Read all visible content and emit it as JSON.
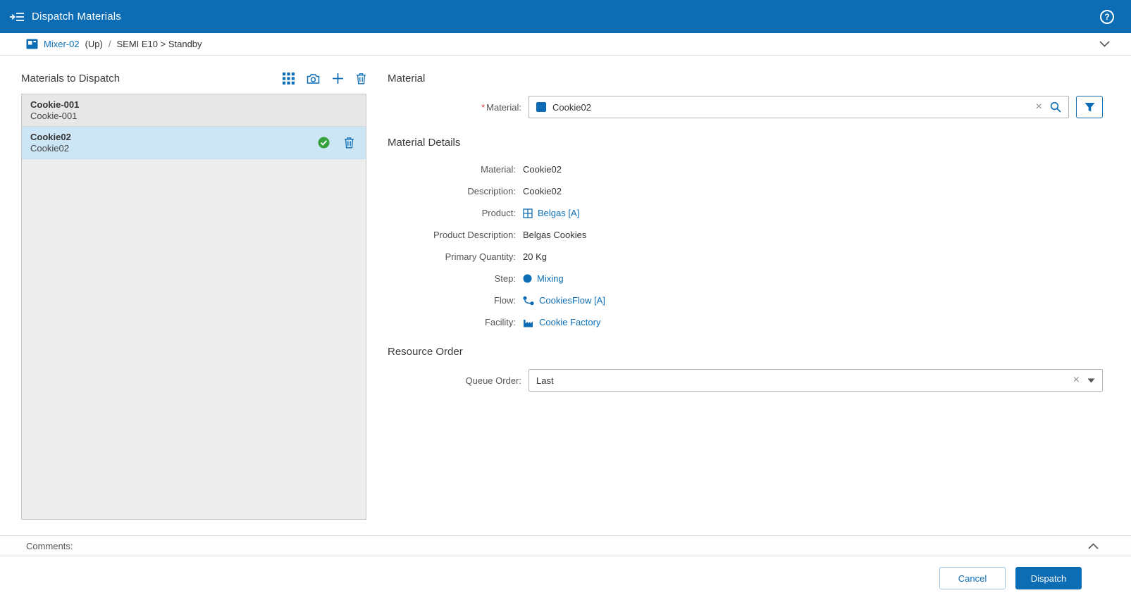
{
  "colors": {
    "accent": "#0d6db4",
    "success": "#37a23c",
    "selected_row_bg": "#cde6f6"
  },
  "header": {
    "title": "Dispatch Materials"
  },
  "breadcrumb": {
    "resource": "Mixer-02",
    "up_label": "(Up)",
    "separator": "/",
    "state": "SEMI E10 > Standby"
  },
  "left_panel": {
    "title": "Materials to Dispatch",
    "items": [
      {
        "name": "Cookie-001",
        "description": "Cookie-001",
        "selected": false
      },
      {
        "name": "Cookie02",
        "description": "Cookie02",
        "selected": true
      }
    ]
  },
  "material_section": {
    "title": "Material",
    "required_marker": "*",
    "label": "Material:",
    "value": "Cookie02"
  },
  "details": {
    "title": "Material Details",
    "rows": [
      {
        "label": "Material:",
        "value": "Cookie02",
        "type": "text"
      },
      {
        "label": "Description:",
        "value": "Cookie02",
        "type": "text"
      },
      {
        "label": "Product:",
        "value": "Belgas [A]",
        "type": "link",
        "icon": "product-icon"
      },
      {
        "label": "Product Description:",
        "value": "Belgas Cookies",
        "type": "text"
      },
      {
        "label": "Primary Quantity:",
        "value": "20 Kg",
        "type": "text"
      },
      {
        "label": "Step:",
        "value": "Mixing",
        "type": "link",
        "icon": "step-icon"
      },
      {
        "label": "Flow:",
        "value": "CookiesFlow [A]",
        "type": "link",
        "icon": "flow-icon"
      },
      {
        "label": "Facility:",
        "value": "Cookie Factory",
        "type": "link",
        "icon": "facility-icon"
      }
    ]
  },
  "resource_order": {
    "title": "Resource Order",
    "label": "Queue Order:",
    "value": "Last"
  },
  "comments": {
    "label": "Comments:"
  },
  "footer": {
    "cancel": "Cancel",
    "dispatch": "Dispatch"
  }
}
